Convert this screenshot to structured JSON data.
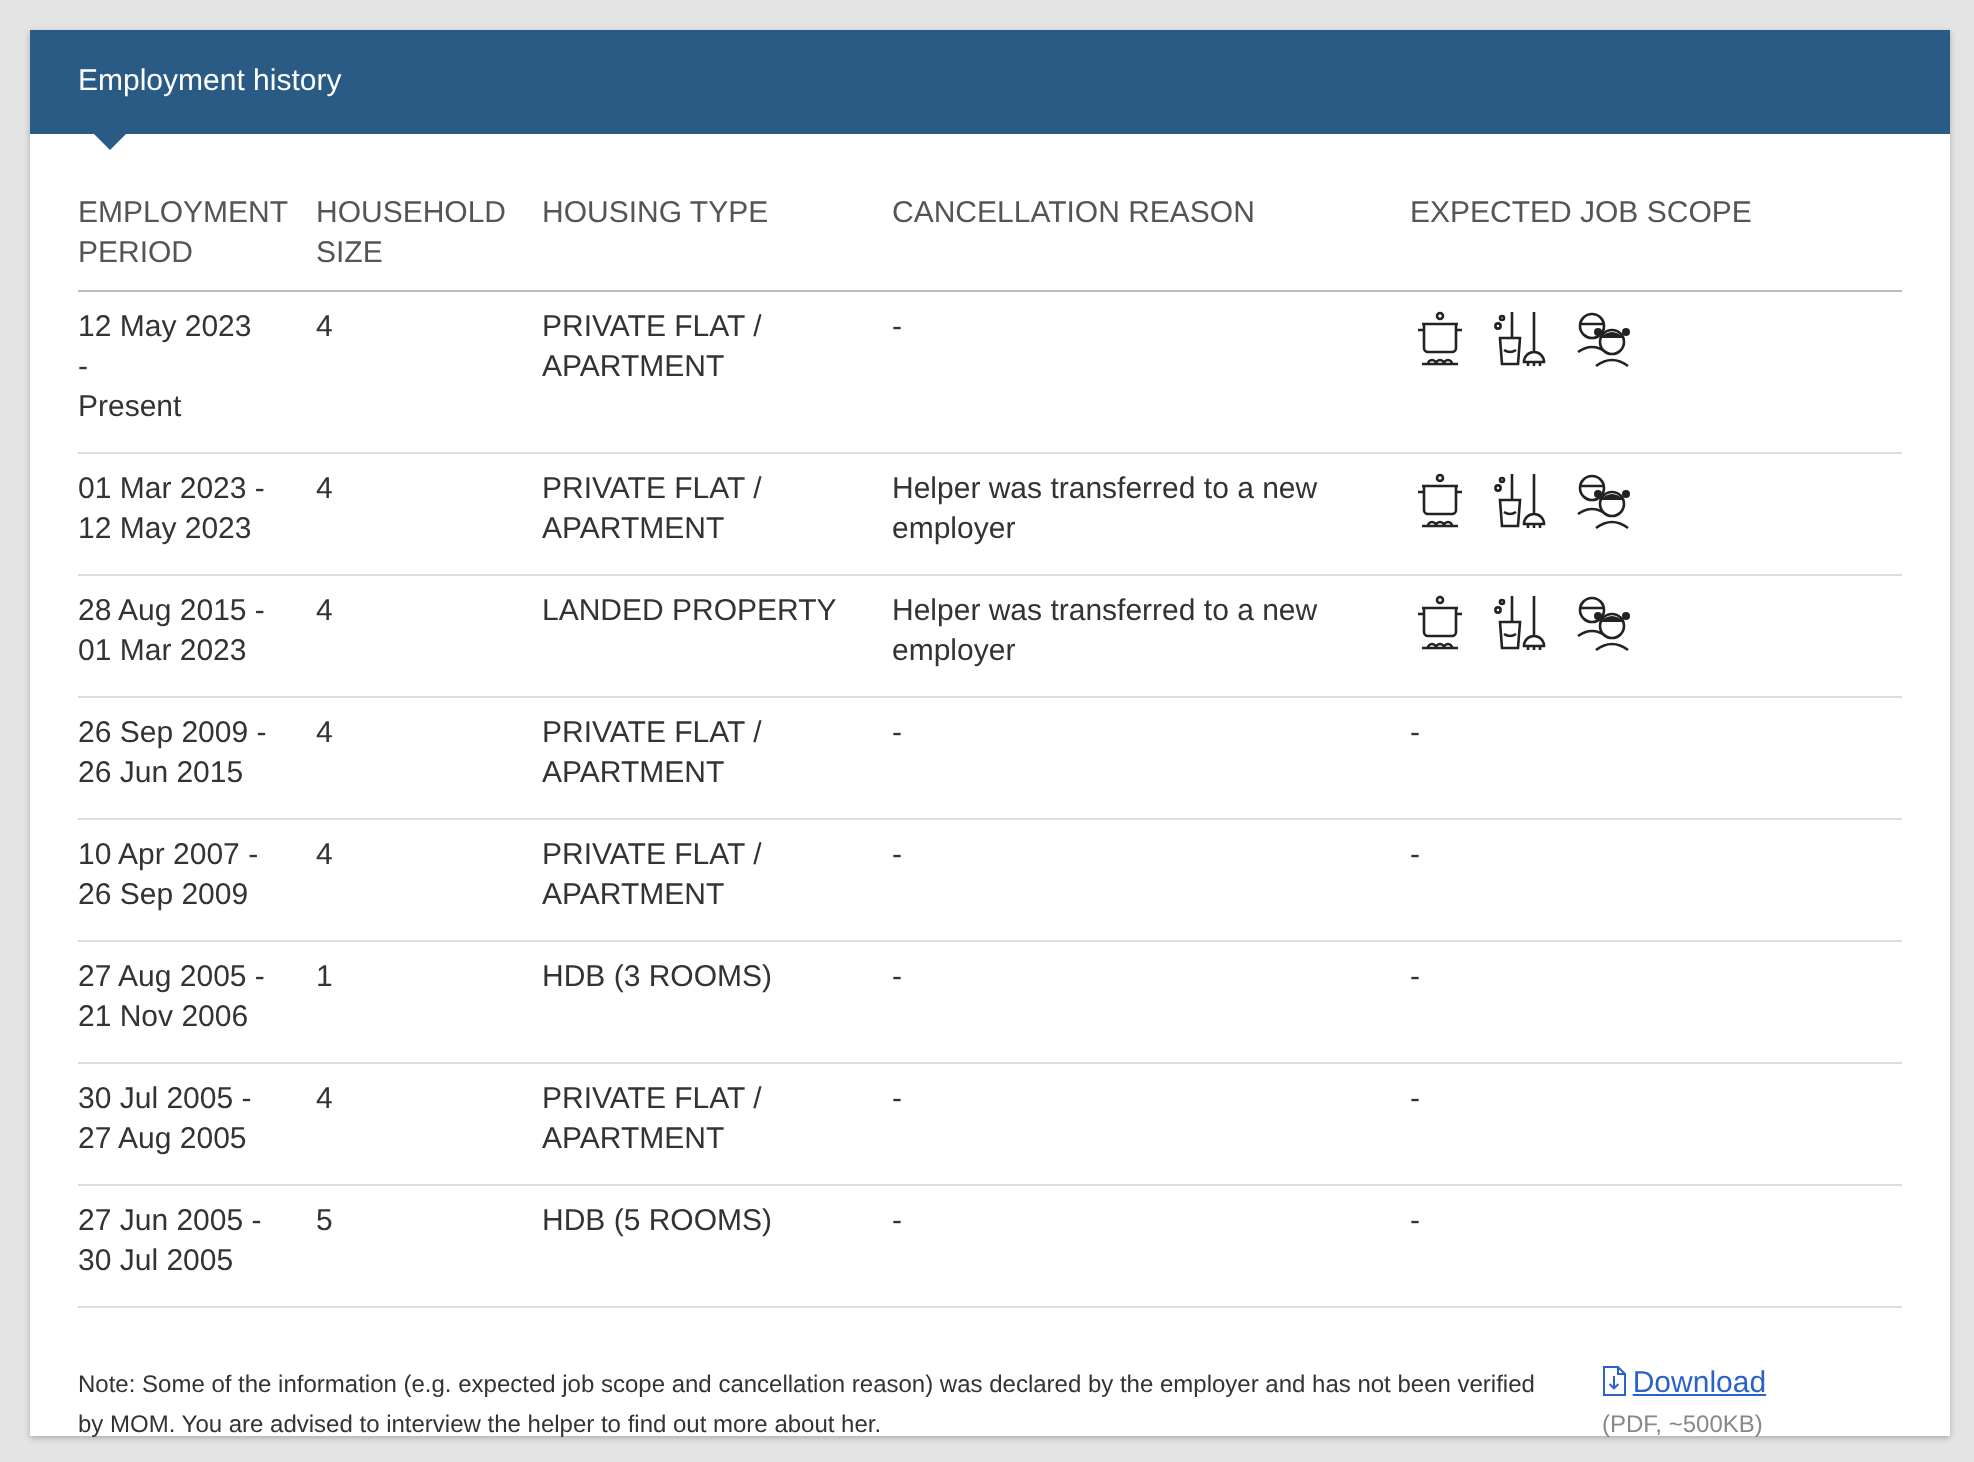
{
  "panel": {
    "title": "Employment history"
  },
  "table": {
    "columns": [
      "EMPLOYMENT PERIOD",
      "HOUSEHOLD SIZE",
      "HOUSING TYPE",
      "CANCELLATION REASON",
      "EXPECTED JOB SCOPE"
    ],
    "rows": [
      {
        "period_lines": [
          "12 May 2023",
          "-",
          "Present"
        ],
        "household_size": "4",
        "housing_type": "PRIVATE FLAT / APARTMENT",
        "cancellation_reason": "-",
        "job_scope": [
          {
            "kind": "cooking"
          },
          {
            "kind": "cleaning"
          },
          {
            "kind": "childcare"
          }
        ]
      },
      {
        "period_lines": [
          "01 Mar 2023 -",
          "12 May 2023"
        ],
        "household_size": "4",
        "housing_type": "PRIVATE FLAT / APARTMENT",
        "cancellation_reason": "Helper was transferred to a new employer",
        "job_scope": [
          {
            "kind": "cooking"
          },
          {
            "kind": "cleaning"
          },
          {
            "kind": "childcare"
          }
        ]
      },
      {
        "period_lines": [
          "28 Aug 2015 -",
          "01 Mar 2023"
        ],
        "household_size": "4",
        "housing_type": "LANDED PROPERTY",
        "cancellation_reason": "Helper was transferred to a new employer",
        "job_scope": [
          {
            "kind": "cooking"
          },
          {
            "kind": "cleaning"
          },
          {
            "kind": "childcare"
          }
        ]
      },
      {
        "period_lines": [
          "26 Sep 2009 -",
          "26 Jun 2015"
        ],
        "household_size": "4",
        "housing_type": "PRIVATE FLAT / APARTMENT",
        "cancellation_reason": "-",
        "job_scope_text": "-"
      },
      {
        "period_lines": [
          "10 Apr 2007 -",
          "26 Sep 2009"
        ],
        "household_size": "4",
        "housing_type": "PRIVATE FLAT / APARTMENT",
        "cancellation_reason": "-",
        "job_scope_text": "-"
      },
      {
        "period_lines": [
          "27 Aug 2005 -",
          "21 Nov 2006"
        ],
        "household_size": "1",
        "housing_type": "HDB (3 ROOMS)",
        "cancellation_reason": "-",
        "job_scope_text": "-"
      },
      {
        "period_lines": [
          "30 Jul 2005 -",
          "27 Aug 2005"
        ],
        "household_size": "4",
        "housing_type": "PRIVATE FLAT / APARTMENT",
        "cancellation_reason": "-",
        "job_scope_text": "-"
      },
      {
        "period_lines": [
          "27 Jun 2005 -",
          "30 Jul 2005"
        ],
        "household_size": "5",
        "housing_type": "HDB (5 ROOMS)",
        "cancellation_reason": "-",
        "job_scope_text": "-"
      }
    ]
  },
  "note": "Note: Some of the information (e.g. expected job scope and cancellation reason) was declared by the employer and has not been verified by MOM. You are advised to interview the helper to find out more about her.",
  "download": {
    "label": "Download",
    "detail": "(PDF, ~500KB)"
  }
}
